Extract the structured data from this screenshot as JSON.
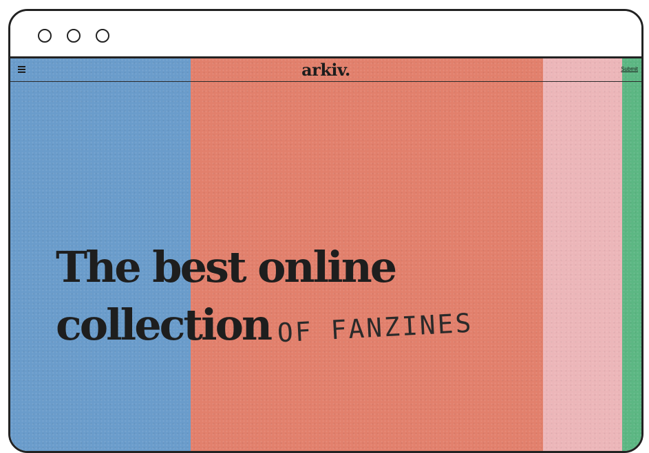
{
  "browser": {
    "window_controls": [
      "circle",
      "circle",
      "circle"
    ]
  },
  "site": {
    "logo": "arkiv.",
    "menu_icon": "hamburger-menu-icon",
    "submit_label": "Submit"
  },
  "hero": {
    "line1": "The best online",
    "line2": "collection",
    "script_text": "OF FANZINES"
  },
  "colors": {
    "blue": "#6a9ccb",
    "coral": "#e2806c",
    "pink": "#ecb6b9",
    "green": "#5cb783",
    "ink": "#1e1e1e",
    "frame": "#222222"
  }
}
